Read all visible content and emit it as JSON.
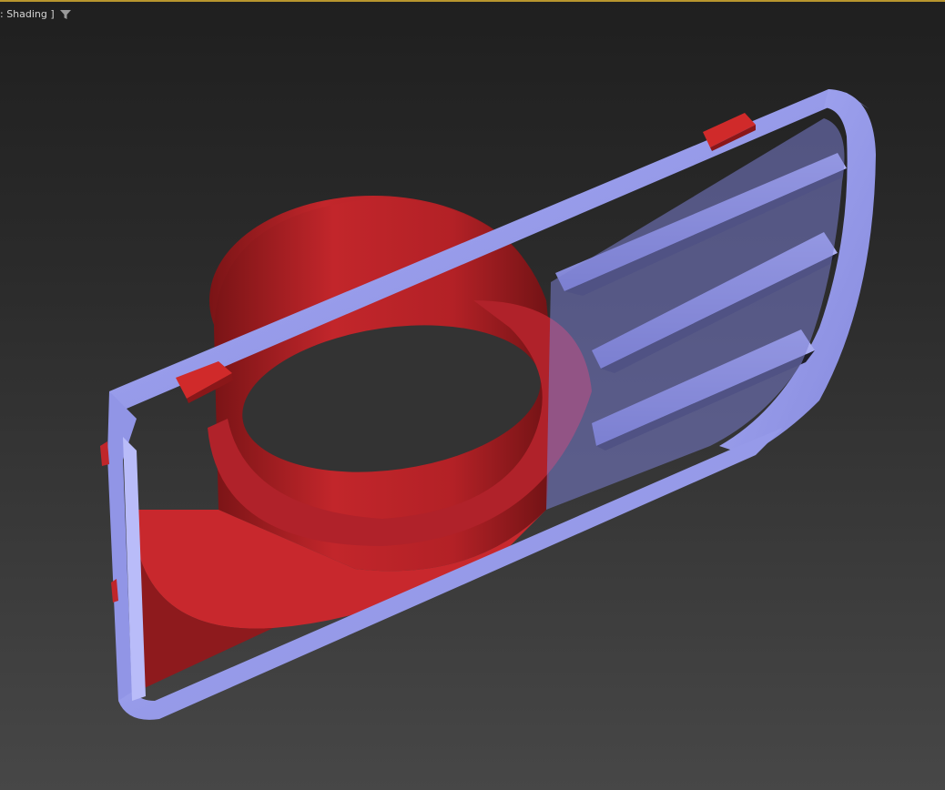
{
  "viewport": {
    "shading_label": ": Shading ]",
    "filter_icon": "funnel-filter-icon",
    "border_color": "#b8962e"
  },
  "scene": {
    "objects": [
      {
        "name": "grille-bezel",
        "color": "#9a9ef0"
      },
      {
        "name": "fog-lamp-housing",
        "color": "#c0252a"
      },
      {
        "name": "mounting-clips",
        "color": "#d02a2a"
      }
    ]
  }
}
